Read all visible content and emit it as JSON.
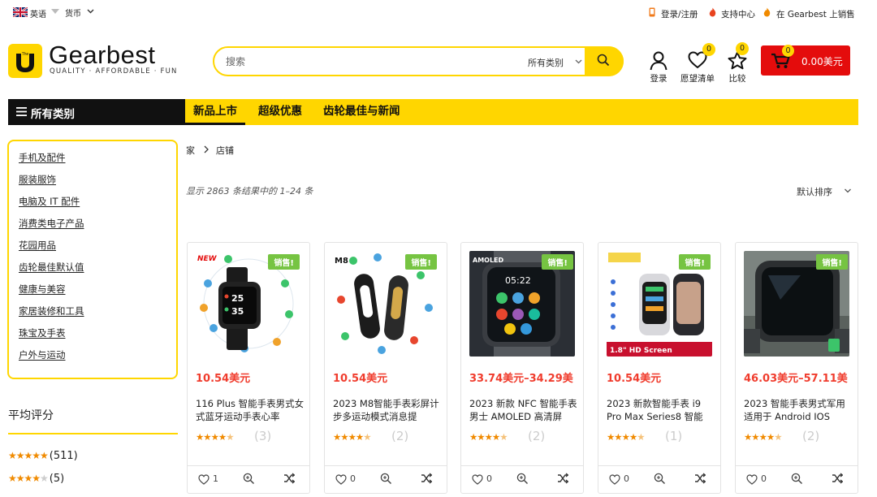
{
  "topbar": {
    "language": "英语",
    "currency": "货币",
    "login_register": "登录/注册",
    "support": "支持中心",
    "sell": "在 Gearbest 上销售"
  },
  "brand": {
    "name": "Gearbest",
    "tagline": "QUALITY · AFFORDABLE · FUN",
    "color": "#ffd600"
  },
  "search": {
    "placeholder": "搜索",
    "category": "所有类别"
  },
  "header_icons": {
    "login": "登录",
    "wishlist": "愿望清单",
    "wishlist_count": "0",
    "compare": "比较",
    "compare_count": "0",
    "cart_count": "0",
    "cart_total": "0.00美元"
  },
  "nav": {
    "all_categories": "所有类别",
    "items": [
      "新品上市",
      "超级优惠",
      "齿轮最佳与新闻"
    ]
  },
  "sidebar": {
    "categories": [
      "手机及配件",
      "服装服饰",
      "电脑及 IT 配件",
      "消费类电子产品",
      "花园用品",
      "齿轮最佳默认值",
      "健康与美容",
      "家居装修和工具",
      "珠宝及手表",
      "户外与运动"
    ],
    "avg_rating_title": "平均评分",
    "ratings": [
      {
        "stars": 5,
        "count": "(511)"
      },
      {
        "stars": 4,
        "count": "(5)"
      }
    ]
  },
  "breadcrumb": {
    "home": "家",
    "current": "店铺"
  },
  "results_text": "显示 2863 条结果中的 1–24 条",
  "sort_label": "默认排序",
  "products": [
    {
      "sale": "销售!",
      "price": "10.54美元",
      "title": "116 Plus 智能手表男式女式蓝牙运动手表心率",
      "rating_count": "(3)",
      "fav_count": "1",
      "img_text": "NEW"
    },
    {
      "sale": "销售!",
      "price": "10.54美元",
      "title": "2023 M8智能手表彩屏计步多运动模式消息提",
      "rating_count": "(2)",
      "fav_count": "0",
      "img_text": "M8"
    },
    {
      "sale": "销售!",
      "price": "33.74美元–34.29美",
      "title": "2023 新款 NFC 智能手表男士 AMOLED 高清屏",
      "rating_count": "(2)",
      "fav_count": "0",
      "img_text": "AMOLED"
    },
    {
      "sale": "销售!",
      "price": "10.54美元",
      "title": "2023 新款智能手表 i9 Pro Max Series8 智能",
      "rating_count": "(1)",
      "fav_count": "0",
      "img_text": "1.8\" HD Screen"
    },
    {
      "sale": "销售!",
      "price": "46.03美元–57.11美",
      "title": "2023 智能手表男式军用适用于 Android IOS",
      "rating_count": "(2)",
      "fav_count": "0",
      "img_text": ""
    }
  ]
}
